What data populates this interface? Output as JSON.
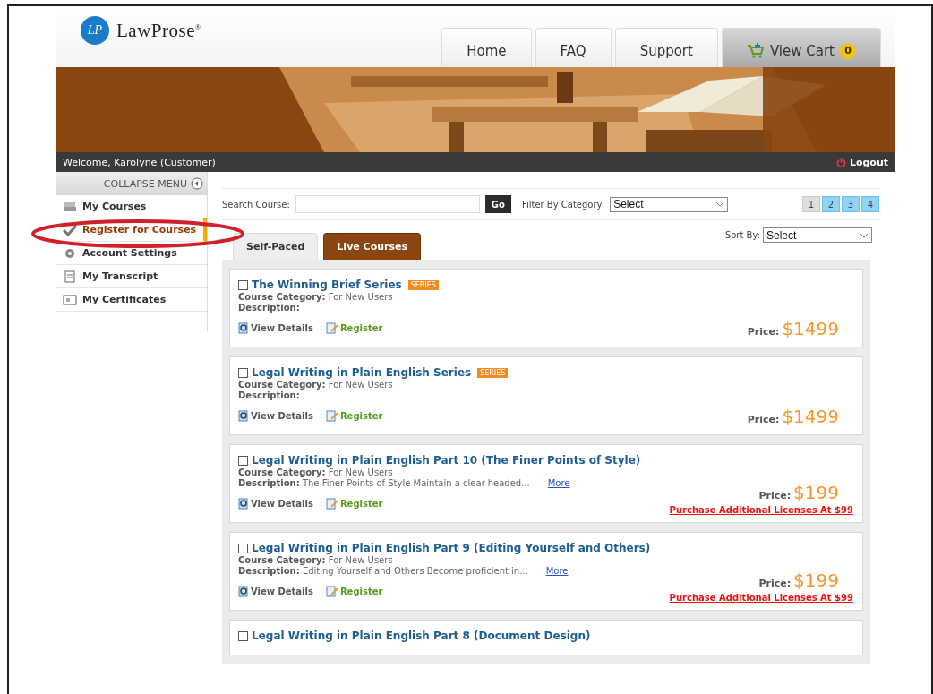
{
  "header": {
    "logo_initials": "LP",
    "logo_text": "LawProse",
    "logo_mark": "®",
    "nav": [
      {
        "label": "Home",
        "selected": false
      },
      {
        "label": "FAQ",
        "selected": false
      },
      {
        "label": "Support",
        "selected": false
      },
      {
        "label": "View Cart",
        "selected": true,
        "badge": "0"
      }
    ]
  },
  "user_bar": {
    "welcome": "Welcome, Karolyne (Customer)",
    "logout": "Logout"
  },
  "sidebar": {
    "collapse": "COLLAPSE MENU",
    "items": [
      {
        "label": "My Courses",
        "selected": false
      },
      {
        "label": "Register for Courses",
        "selected": true
      },
      {
        "label": "Account Settings",
        "selected": false
      },
      {
        "label": "My Transcript",
        "selected": false
      },
      {
        "label": "My Certificates",
        "selected": false
      }
    ]
  },
  "annotation": {
    "kind": "ellipse",
    "color": "#d0202a"
  },
  "search": {
    "label": "Search Course:",
    "button": "Go",
    "filter_label": "Filter By Category:",
    "filter_value": "Select"
  },
  "pagination": [
    {
      "label": "1",
      "selected": true
    },
    {
      "label": "2",
      "selected": false
    },
    {
      "label": "3",
      "selected": false
    },
    {
      "label": "4",
      "selected": false
    }
  ],
  "tabs": [
    {
      "label": "Self-Paced",
      "selected": true
    },
    {
      "label": "Live Courses",
      "selected": false
    }
  ],
  "sort": {
    "label": "Sort By:",
    "value": "Select"
  },
  "courses": [
    {
      "title": "The Winning Brief Series",
      "checked": false,
      "badge": "SERIES",
      "category_label": "Course Category:",
      "category": "For New Users",
      "description_label": "Description:",
      "view_details": "View Details",
      "register": "Register",
      "price_label": "Price:",
      "price": "$1499"
    },
    {
      "title": "Legal Writing in Plain English Series",
      "checked": false,
      "badge": "SERIES",
      "category_label": "Course Category:",
      "category": "For New Users",
      "description_label": "Description:",
      "view_details": "View Details",
      "register": "Register",
      "price_label": "Price:",
      "price": "$1499"
    },
    {
      "title": "Legal Writing in Plain English Part 10 (The Finer Points of Style)",
      "checked": false,
      "category_label": "Course Category:",
      "category": "For New Users",
      "description_label": "Description:",
      "description": "The Finer Points of Style Maintain a clear-headed...",
      "more": "More",
      "view_details": "View Details",
      "register": "Register",
      "price_label": "Price:",
      "price": "$199",
      "license": "Purchase Additional Licenses At $99"
    },
    {
      "title": "Legal Writing in Plain English Part 9 (Editing Yourself and Others)",
      "checked": false,
      "category_label": "Course Category:",
      "category": "For New Users",
      "description_label": "Description:",
      "description": "Editing Yourself and Others Become proficient in...",
      "more": "More",
      "view_details": "View Details",
      "register": "Register",
      "price_label": "Price:",
      "price": "$199",
      "license": "Purchase Additional Licenses At $99"
    },
    {
      "title": "Legal Writing in Plain English Part 8 (Document Design)",
      "checked": false
    }
  ]
}
